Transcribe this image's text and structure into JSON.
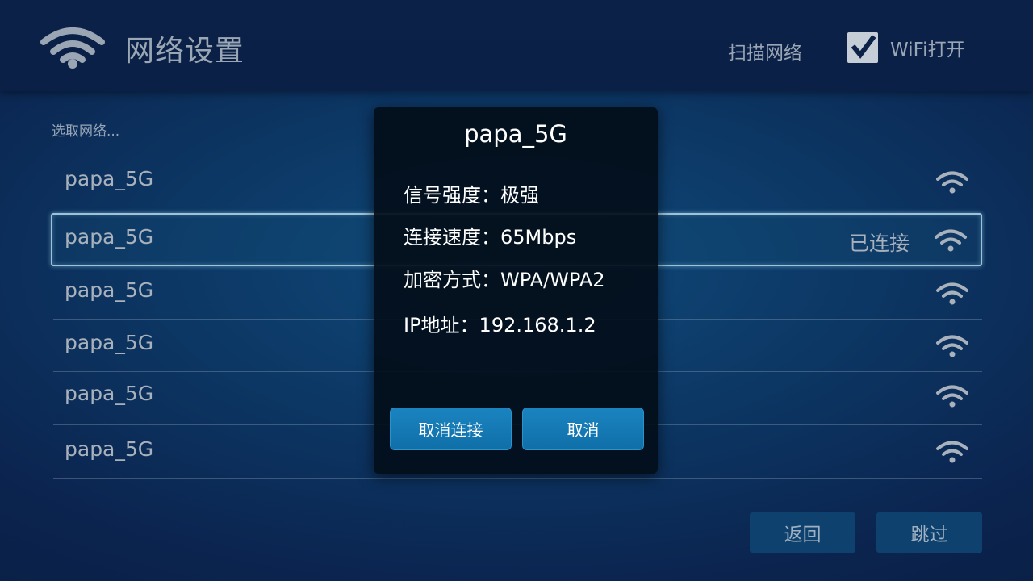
{
  "header": {
    "title": "网络设置",
    "scan_label": "扫描网络",
    "wifi_toggle_label": "WiFi打开",
    "wifi_enabled": true,
    "icon": "wifi-icon"
  },
  "network_list": {
    "section_label": "选取网络...",
    "networks": [
      {
        "name": "papa_5G",
        "status": "",
        "selected": false
      },
      {
        "name": "papa_5G",
        "status": "已连接",
        "selected": true
      },
      {
        "name": "papa_5G",
        "status": "",
        "selected": false
      },
      {
        "name": "papa_5G",
        "status": "",
        "selected": false
      },
      {
        "name": "papa_5G",
        "status": "",
        "selected": false
      },
      {
        "name": "papa_5G",
        "status": "",
        "selected": false
      }
    ]
  },
  "dialog": {
    "title": "papa_5G",
    "signal_strength": "信号强度：极强",
    "link_speed": "连接速度：65Mbps",
    "encryption": "加密方式：WPA/WPA2",
    "ip_address": "IP地址：192.168.1.2",
    "disconnect_label": "取消连接",
    "cancel_label": "取消"
  },
  "footer": {
    "back_label": "返回",
    "skip_label": "跳过"
  },
  "colors": {
    "accent": "#1a84c0",
    "selection_border": "#9fc3d6",
    "header_bg": "#0b2147"
  }
}
